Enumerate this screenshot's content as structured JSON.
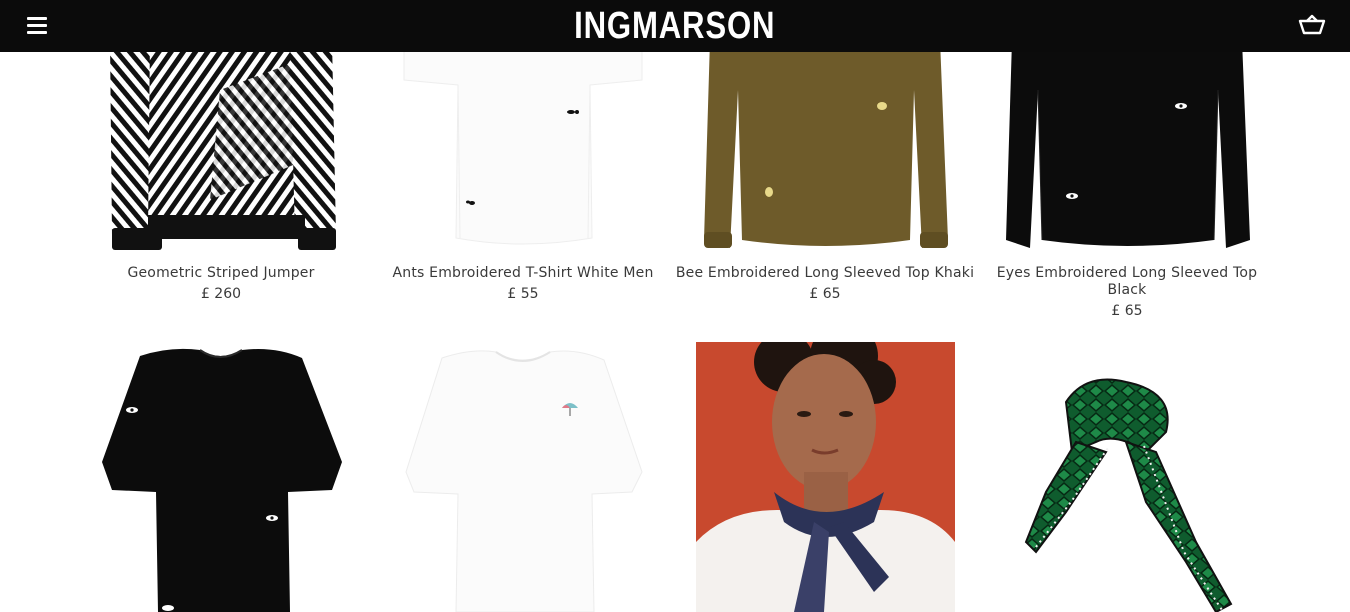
{
  "header": {
    "brand": "INGMARSON",
    "menu_icon": "hamburger-menu-icon",
    "cart_icon": "basket-icon",
    "background": "#0b0b0b"
  },
  "products": [
    {
      "title": "Geometric Striped Jumper",
      "price": "£ 260"
    },
    {
      "title": "Ants Embroidered T-Shirt White Men",
      "price": "£ 55"
    },
    {
      "title": "Bee Embroidered Long Sleeved Top Khaki",
      "price": "£ 65"
    },
    {
      "title": "Eyes Embroidered Long Sleeved Top Black",
      "price": "£ 65"
    },
    {
      "title": "",
      "price": ""
    },
    {
      "title": "",
      "price": ""
    },
    {
      "title": "",
      "price": ""
    },
    {
      "title": "",
      "price": ""
    }
  ]
}
